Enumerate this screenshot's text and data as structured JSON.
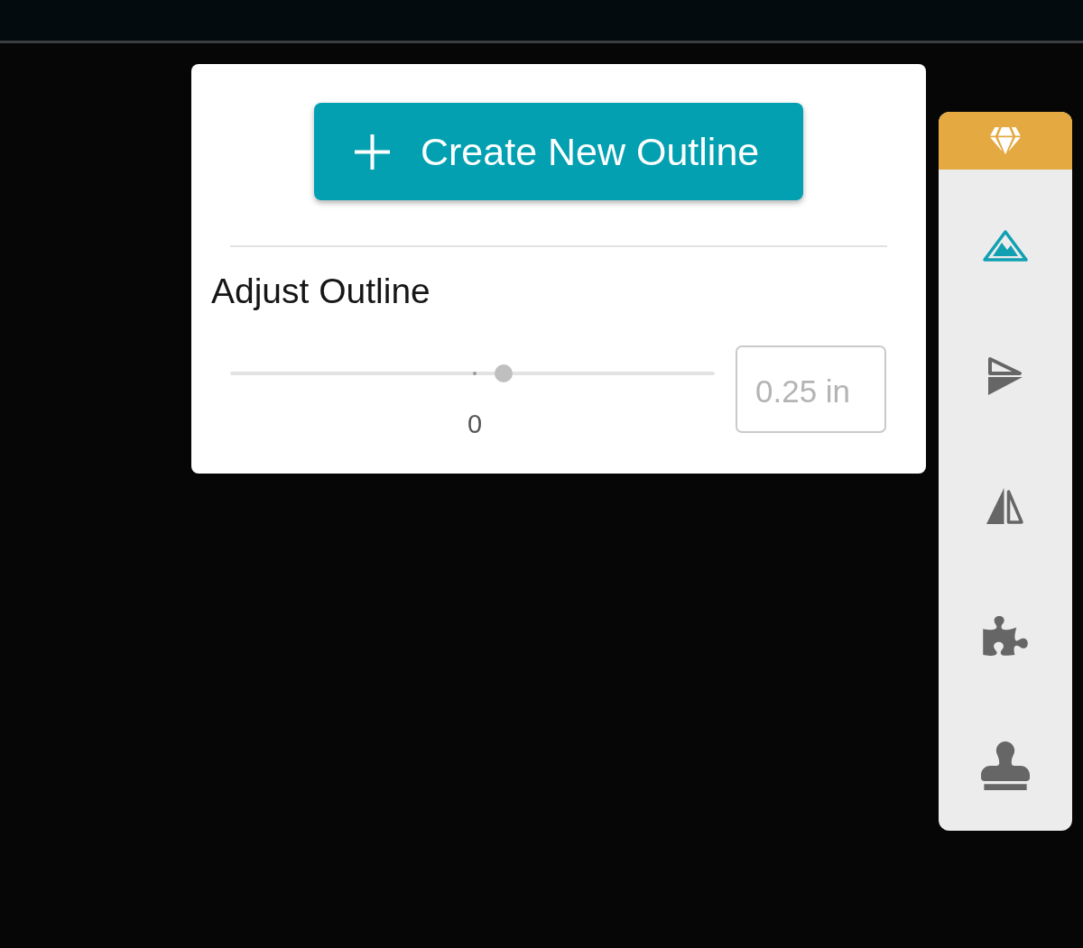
{
  "outline_panel": {
    "create_button": {
      "label": "Create New Outline"
    },
    "adjust_title": "Adjust Outline",
    "slider": {
      "level": 0.564,
      "marks": [
        {
          "label": "0",
          "level": 0.505
        }
      ]
    },
    "size_field": {
      "placeholder": "0.25 in"
    }
  },
  "toolbar": {
    "items": [
      {
        "selected": true
      },
      {
        "selected": false
      },
      {
        "selected": false
      },
      {
        "selected": false
      },
      {
        "selected": false
      }
    ]
  }
}
